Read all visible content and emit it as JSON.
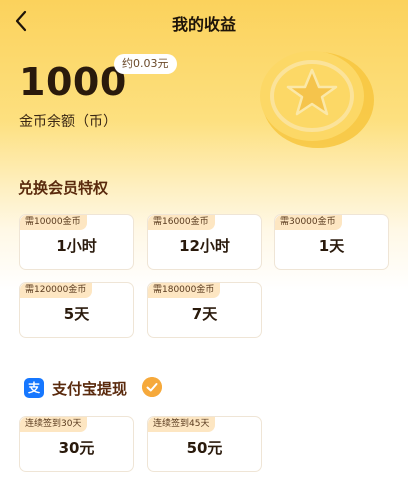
{
  "header": {
    "title": "我的收益",
    "back_icon": "back-arrow-icon"
  },
  "balance": {
    "amount": "1000",
    "approx": "约0.03元",
    "label": "金币余额（币）"
  },
  "vip_section": {
    "title": "兑换会员特权",
    "options": [
      {
        "tag": "需10000金币",
        "value": "1小时"
      },
      {
        "tag": "需16000金币",
        "value": "12小时"
      },
      {
        "tag": "需30000金币",
        "value": "1天"
      },
      {
        "tag": "需120000金币",
        "value": "5天"
      },
      {
        "tag": "需180000金币",
        "value": "7天"
      }
    ]
  },
  "alipay_section": {
    "icon_text": "支",
    "label": "支付宝提现",
    "selected": true,
    "options": [
      {
        "tag": "连续签到30天",
        "value": "30元"
      },
      {
        "tag": "连续签到45天",
        "value": "50元"
      }
    ]
  },
  "colors": {
    "accent": "#f6a93b",
    "alipay_blue": "#1677ff",
    "tag_bg": "#fde6c2"
  }
}
